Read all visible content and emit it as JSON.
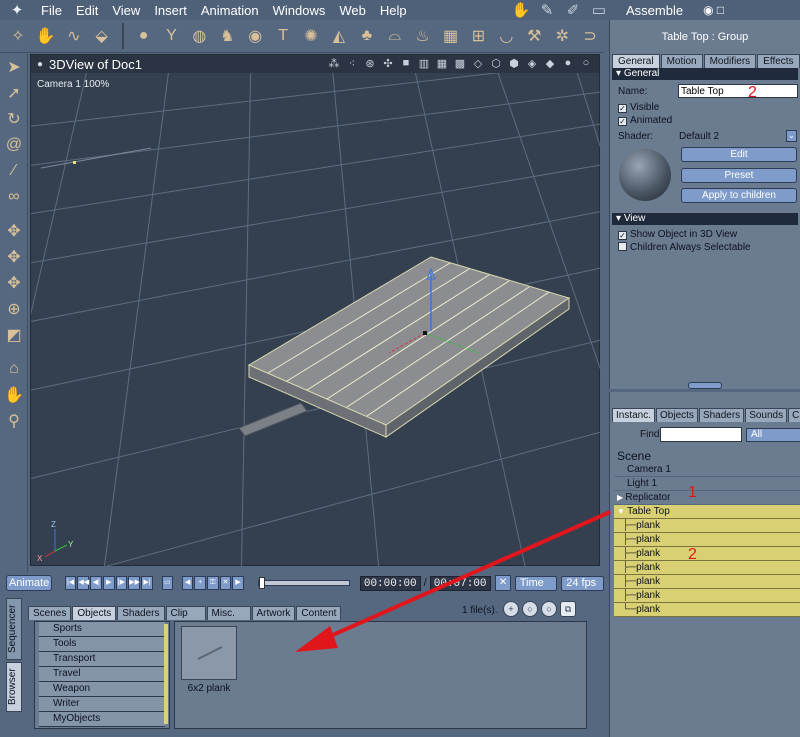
{
  "menubar": {
    "items": [
      "File",
      "Edit",
      "View",
      "Insert",
      "Animation",
      "Windows",
      "Web",
      "Help"
    ],
    "room": "Assemble"
  },
  "viewport": {
    "title": "3DView of Doc1",
    "camera_label": "Camera 1 100%"
  },
  "timeline": {
    "animate_label": "Animate",
    "current_time": "00:00:00",
    "end_time": "00:07:00",
    "time_mode": "Time",
    "fps": "24 fps"
  },
  "library": {
    "side_tabs": [
      "Sequencer",
      "Browser"
    ],
    "tabs": [
      "Scenes",
      "Objects",
      "Shaders",
      "Clip",
      "Misc.",
      "Artwork",
      "Content"
    ],
    "file_count": "1 file(s).",
    "categories": [
      "Sports",
      "Tools",
      "Transport",
      "Travel",
      "Weapon",
      "Writer",
      "MyObjects"
    ],
    "item_label": "6x2 plank"
  },
  "properties": {
    "title": "Table Top : Group",
    "tabs": [
      "General",
      "Motion",
      "Modifiers",
      "Effects"
    ],
    "general_header": "General",
    "name_label": "Name:",
    "name_value": "Table Top",
    "visible_label": "Visible",
    "animated_label": "Animated",
    "shader_label": "Shader:",
    "shader_value": "Default 2",
    "edit_label": "Edit",
    "preset_label": "Preset",
    "apply_label": "Apply to children",
    "view_header": "View",
    "show_object_label": "Show Object in 3D View",
    "children_selectable_label": "Children Always Selectable"
  },
  "scene": {
    "tabs": [
      "Instanc.",
      "Objects",
      "Shaders",
      "Sounds",
      "Clips"
    ],
    "find_label": "Find:",
    "find_scope": "All",
    "header": "Scene",
    "items": [
      "Camera 1",
      "Light 1",
      "Replicator",
      "Table Top",
      "plank",
      "plank",
      "plank",
      "plank",
      "plank",
      "plank",
      "plank"
    ]
  },
  "annotations": {
    "label_1": "1",
    "label_2a": "2",
    "label_2b": "2",
    "color": "#e0161c"
  },
  "colors": {
    "panel": "#6b7b90",
    "selection": "#d8d072",
    "button": "#7e9bc9",
    "viewport_bg": "#34404f"
  }
}
